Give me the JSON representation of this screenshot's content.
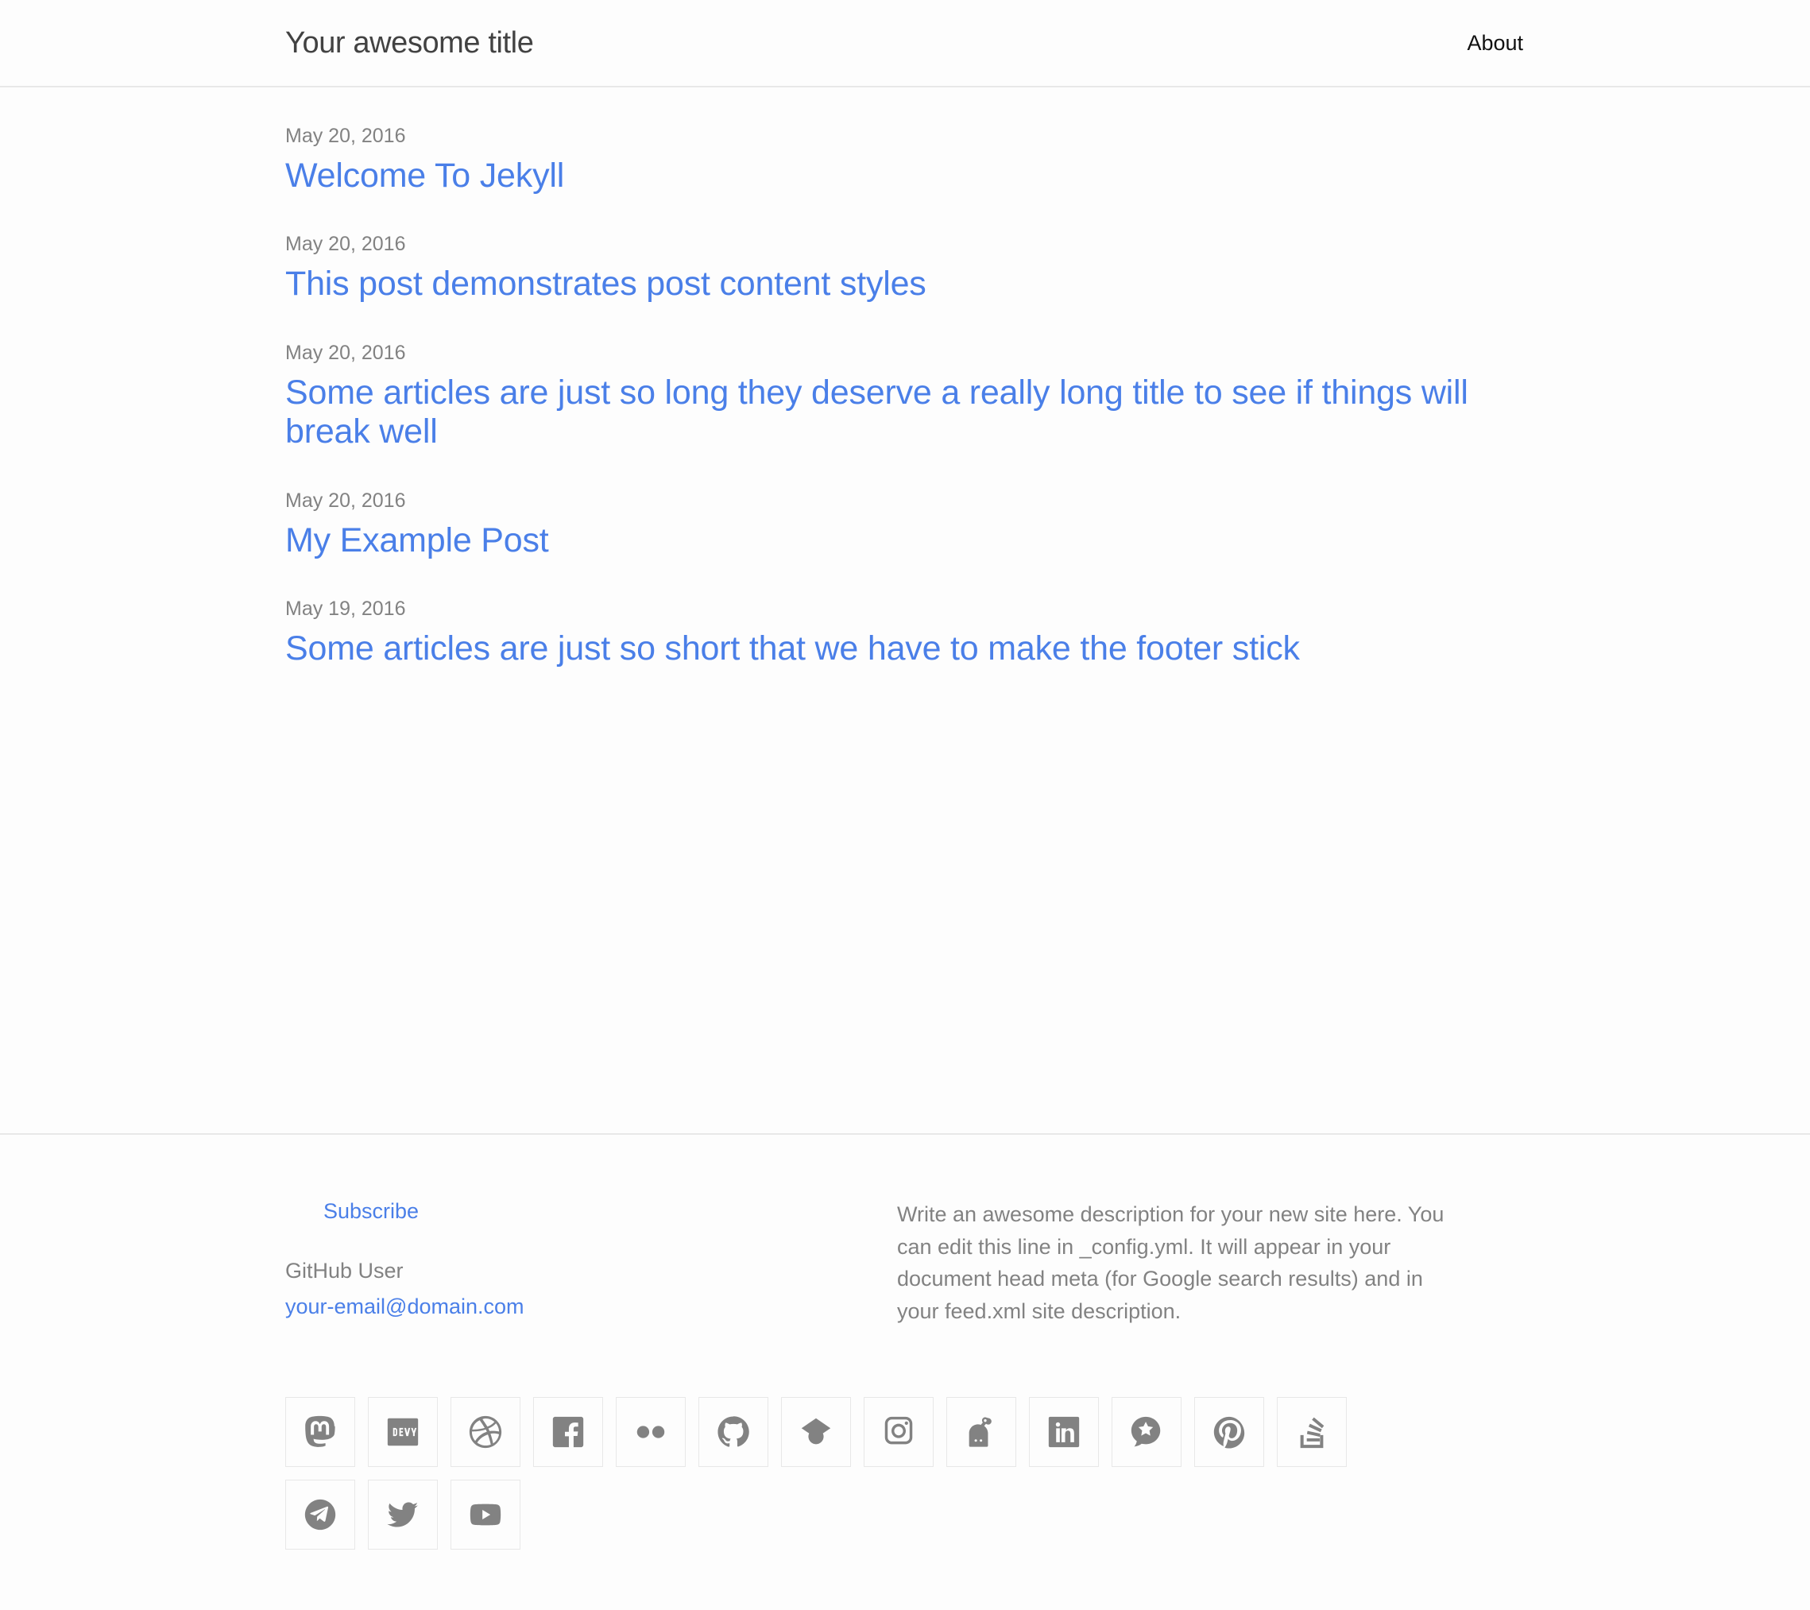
{
  "header": {
    "site_title": "Your awesome title",
    "nav": [
      {
        "label": "About",
        "name": "nav-link-about"
      }
    ]
  },
  "main": {
    "posts": [
      {
        "date": "May 20, 2016",
        "title": "Welcome To Jekyll"
      },
      {
        "date": "May 20, 2016",
        "title": "This post demonstrates post content styles"
      },
      {
        "date": "May 20, 2016",
        "title": "Some articles are just so long they deserve a really long title to see if things will break well"
      },
      {
        "date": "May 20, 2016",
        "title": "My Example Post"
      },
      {
        "date": "May 19, 2016",
        "title": "Some articles are just so short that we have to make the footer stick"
      }
    ]
  },
  "footer": {
    "subscribe_label": "Subscribe",
    "contact": {
      "github_user": "GitHub User",
      "email": "your-email@domain.com"
    },
    "description": "Write an awesome description for your new site here. You can edit this line in _config.yml. It will appear in your document head meta (for Google search results) and in your feed.xml site description.",
    "social": [
      {
        "name": "mastodon-icon",
        "label": "Mastodon"
      },
      {
        "name": "dev-icon",
        "label": "DEV"
      },
      {
        "name": "dribbble-icon",
        "label": "Dribbble"
      },
      {
        "name": "facebook-icon",
        "label": "Facebook"
      },
      {
        "name": "flickr-icon",
        "label": "Flickr"
      },
      {
        "name": "github-icon",
        "label": "GitHub"
      },
      {
        "name": "google-scholar-icon",
        "label": "Google Scholar"
      },
      {
        "name": "instagram-icon",
        "label": "Instagram"
      },
      {
        "name": "keybase-icon",
        "label": "Keybase"
      },
      {
        "name": "linkedin-icon",
        "label": "LinkedIn"
      },
      {
        "name": "microsoft-icon",
        "label": "Microsoft"
      },
      {
        "name": "pinterest-icon",
        "label": "Pinterest"
      },
      {
        "name": "stackoverflow-icon",
        "label": "Stack Overflow"
      },
      {
        "name": "telegram-icon",
        "label": "Telegram"
      },
      {
        "name": "twitter-icon",
        "label": "Twitter"
      },
      {
        "name": "youtube-icon",
        "label": "YouTube"
      }
    ]
  },
  "colors": {
    "link": "#4a7fe8",
    "text": "#111111",
    "muted": "#828282",
    "border": "#e8e8e8",
    "background": "#fdfdfd",
    "icon": "#828282"
  }
}
